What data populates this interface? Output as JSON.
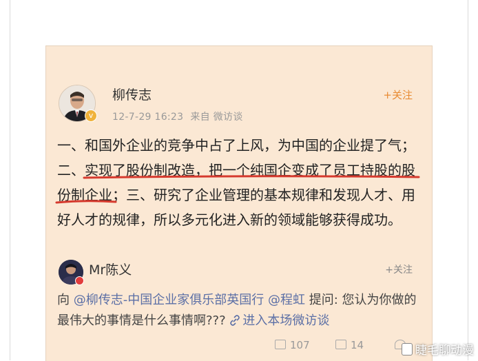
{
  "post": {
    "author": "柳传志",
    "time": "12-7-29 16:23",
    "source": "来自 微访谈",
    "follow_label": "+关注",
    "segments": [
      {
        "text": "一、和国外企业的竞争中占了上风，为中国的企业提了气；二、",
        "highlight": false
      },
      {
        "text": "实现了股份制改造，把一个纯国企变成了员工持股的股份制企业",
        "highlight": true
      },
      {
        "text": "；三、研究了企业管理的基本规律和发现人才、用好人才的规律，所以多元化进入新的领域能够获得成功。",
        "highlight": false
      }
    ]
  },
  "reply": {
    "author": "Mr陈义",
    "follow_label": "+关注",
    "prefix": "向 ",
    "mention1": "@柳传志-中国企业家俱乐部英国行",
    "space": " ",
    "mention2": "@程虹",
    "question": " 提问: 您认为你做的最伟大的事情是什么事情啊???",
    "link": "进入本场微访谈",
    "repost_count": "107",
    "comment_count": "14",
    "like_count": ""
  },
  "watermark": "睫毛聊动漫",
  "colors": {
    "card_bg": "#fbe8d4",
    "accent_orange": "#e88b33",
    "link_blue": "#5b6fa6",
    "underline_red": "#d63a2e"
  }
}
